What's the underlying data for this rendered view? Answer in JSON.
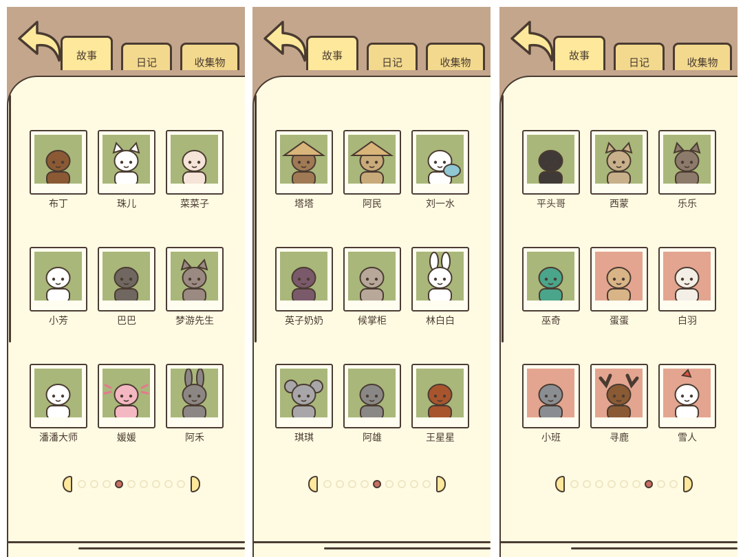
{
  "colors": {
    "header_brown": "#c4a68d",
    "paper": "#fffbe3",
    "ink": "#4a3b31",
    "tab_active": "#fde89b",
    "tab_inactive": "#f2d98e",
    "portrait_green": "#a9b77a",
    "portrait_pink": "#e3a590",
    "dot_active": "#c96e63"
  },
  "screens": [
    {
      "back_icon": "back-arrow-icon",
      "tabs": [
        {
          "label": "故事",
          "active": true
        },
        {
          "label": "日记",
          "active": false
        },
        {
          "label": "收集物",
          "active": false
        }
      ],
      "characters": [
        {
          "name": "布丁",
          "bg": "#a9b77a",
          "animal": "shaggy-dog",
          "fur": "#8b5a34"
        },
        {
          "name": "珠儿",
          "bg": "#a9b77a",
          "animal": "white-cat",
          "fur": "#ffffff"
        },
        {
          "name": "菜菜子",
          "bg": "#a9b77a",
          "animal": "sheep",
          "fur": "#f6e4d8"
        },
        {
          "name": "小芳",
          "bg": "#a9b77a",
          "animal": "cow",
          "fur": "#ffffff"
        },
        {
          "name": "巴巴",
          "bg": "#a9b77a",
          "animal": "schnauzer",
          "fur": "#6f6760"
        },
        {
          "name": "梦游先生",
          "bg": "#a9b77a",
          "animal": "mouse",
          "fur": "#9a8a82"
        },
        {
          "name": "潘潘大师",
          "bg": "#a9b77a",
          "animal": "panda",
          "fur": "#ffffff"
        },
        {
          "name": "媛媛",
          "bg": "#a9b77a",
          "animal": "axolotl",
          "fur": "#f4b8c2"
        },
        {
          "name": "阿禾",
          "bg": "#a9b77a",
          "animal": "donkey",
          "fur": "#8c8784"
        }
      ],
      "pager": {
        "total": 9,
        "current": 4
      }
    },
    {
      "back_icon": "back-arrow-icon",
      "tabs": [
        {
          "label": "故事",
          "active": true
        },
        {
          "label": "日记",
          "active": false
        },
        {
          "label": "收集物",
          "active": false
        }
      ],
      "characters": [
        {
          "name": "塔塔",
          "bg": "#a9b77a",
          "animal": "straw-hat",
          "fur": "#a07a55"
        },
        {
          "name": "阿民",
          "bg": "#a9b77a",
          "animal": "straw-coat",
          "fur": "#c9aa7a"
        },
        {
          "name": "刘一水",
          "bg": "#a9b77a",
          "animal": "goose",
          "fur": "#ffffff"
        },
        {
          "name": "英子奶奶",
          "bg": "#a9b77a",
          "animal": "grandma",
          "fur": "#7a5a6a"
        },
        {
          "name": "候掌柜",
          "bg": "#a9b77a",
          "animal": "monkey",
          "fur": "#b8a89a"
        },
        {
          "name": "林白白",
          "bg": "#a9b77a",
          "animal": "rabbit",
          "fur": "#ffffff"
        },
        {
          "name": "琪琪",
          "bg": "#a9b77a",
          "animal": "koala",
          "fur": "#a8a6a8"
        },
        {
          "name": "阿雄",
          "bg": "#a9b77a",
          "animal": "seal",
          "fur": "#8a8886"
        },
        {
          "name": "王星星",
          "bg": "#a9b77a",
          "animal": "orangutan",
          "fur": "#a8552e"
        }
      ],
      "pager": {
        "total": 9,
        "current": 5
      }
    },
    {
      "back_icon": "back-arrow-icon",
      "tabs": [
        {
          "label": "故事",
          "active": true
        },
        {
          "label": "日记",
          "active": false
        },
        {
          "label": "收集物",
          "active": false
        }
      ],
      "characters": [
        {
          "name": "平头哥",
          "bg": "#a9b77a",
          "animal": "honey-badger",
          "fur": "#3f3a38"
        },
        {
          "name": "西蒙",
          "bg": "#a9b77a",
          "animal": "meerkat",
          "fur": "#c8b08a"
        },
        {
          "name": "乐乐",
          "bg": "#a9b77a",
          "animal": "raccoon",
          "fur": "#8c7a6a"
        },
        {
          "name": "巫奇",
          "bg": "#a9b77a",
          "animal": "chameleon",
          "fur": "#4aa58a"
        },
        {
          "name": "蛋蛋",
          "bg": "#e3a590",
          "animal": "egg",
          "fur": "#d8b487"
        },
        {
          "name": "白羽",
          "bg": "#e3a590",
          "animal": "bird",
          "fur": "#f4efe6"
        },
        {
          "name": "小班",
          "bg": "#e3a590",
          "animal": "otter",
          "fur": "#8a8e92"
        },
        {
          "name": "寻鹿",
          "bg": "#e3a590",
          "animal": "moose",
          "fur": "#8a5a34"
        },
        {
          "name": "雪人",
          "bg": "#e3a590",
          "animal": "snowman",
          "fur": "#ffffff"
        }
      ],
      "pager": {
        "total": 9,
        "current": 7
      }
    }
  ]
}
